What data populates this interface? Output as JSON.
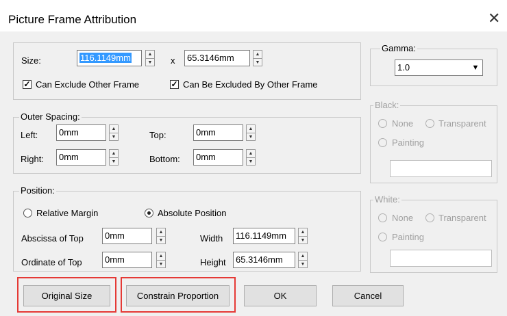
{
  "dialog": {
    "title": "Picture Frame Attribution",
    "close_glyph": "✕"
  },
  "size": {
    "label": "Size:",
    "width_value": "116.1149mm",
    "x_label": "x",
    "height_value": "65.3146mm",
    "can_exclude_label": "Can Exclude Other Frame",
    "can_exclude_checked": true,
    "excluded_by_label": "Can Be Excluded By Other Frame",
    "excluded_by_checked": true
  },
  "outer_spacing": {
    "legend": "Outer Spacing:",
    "left_label": "Left:",
    "left_value": "0mm",
    "top_label": "Top:",
    "top_value": "0mm",
    "right_label": "Right:",
    "right_value": "0mm",
    "bottom_label": "Bottom:",
    "bottom_value": "0mm"
  },
  "position": {
    "legend": "Position:",
    "relative_label": "Relative Margin",
    "absolute_label": "Absolute Position",
    "selected": "absolute",
    "abscissa_label": "Abscissa of Top",
    "abscissa_value": "0mm",
    "ordinate_label": "Ordinate of Top",
    "ordinate_value": "0mm",
    "width_label": "Width",
    "width_value": "116.1149mm",
    "height_label": "Height",
    "height_value": "65.3146mm"
  },
  "gamma": {
    "legend": "Gamma:",
    "value": "1.0"
  },
  "black": {
    "legend": "Black:",
    "none_label": "None",
    "transparent_label": "Transparent",
    "painting_label": "Painting"
  },
  "white": {
    "legend": "White:",
    "none_label": "None",
    "transparent_label": "Transparent",
    "painting_label": "Painting"
  },
  "buttons": {
    "original_size": "Original Size",
    "constrain_proportion": "Constrain Proportion",
    "ok": "OK",
    "cancel": "Cancel"
  },
  "colors": {
    "highlight_box": "#e53935",
    "selection": "#3399ff"
  },
  "icons": {
    "spin_up": "▲",
    "spin_down": "▼",
    "dropdown": "▼",
    "check": "✓"
  }
}
